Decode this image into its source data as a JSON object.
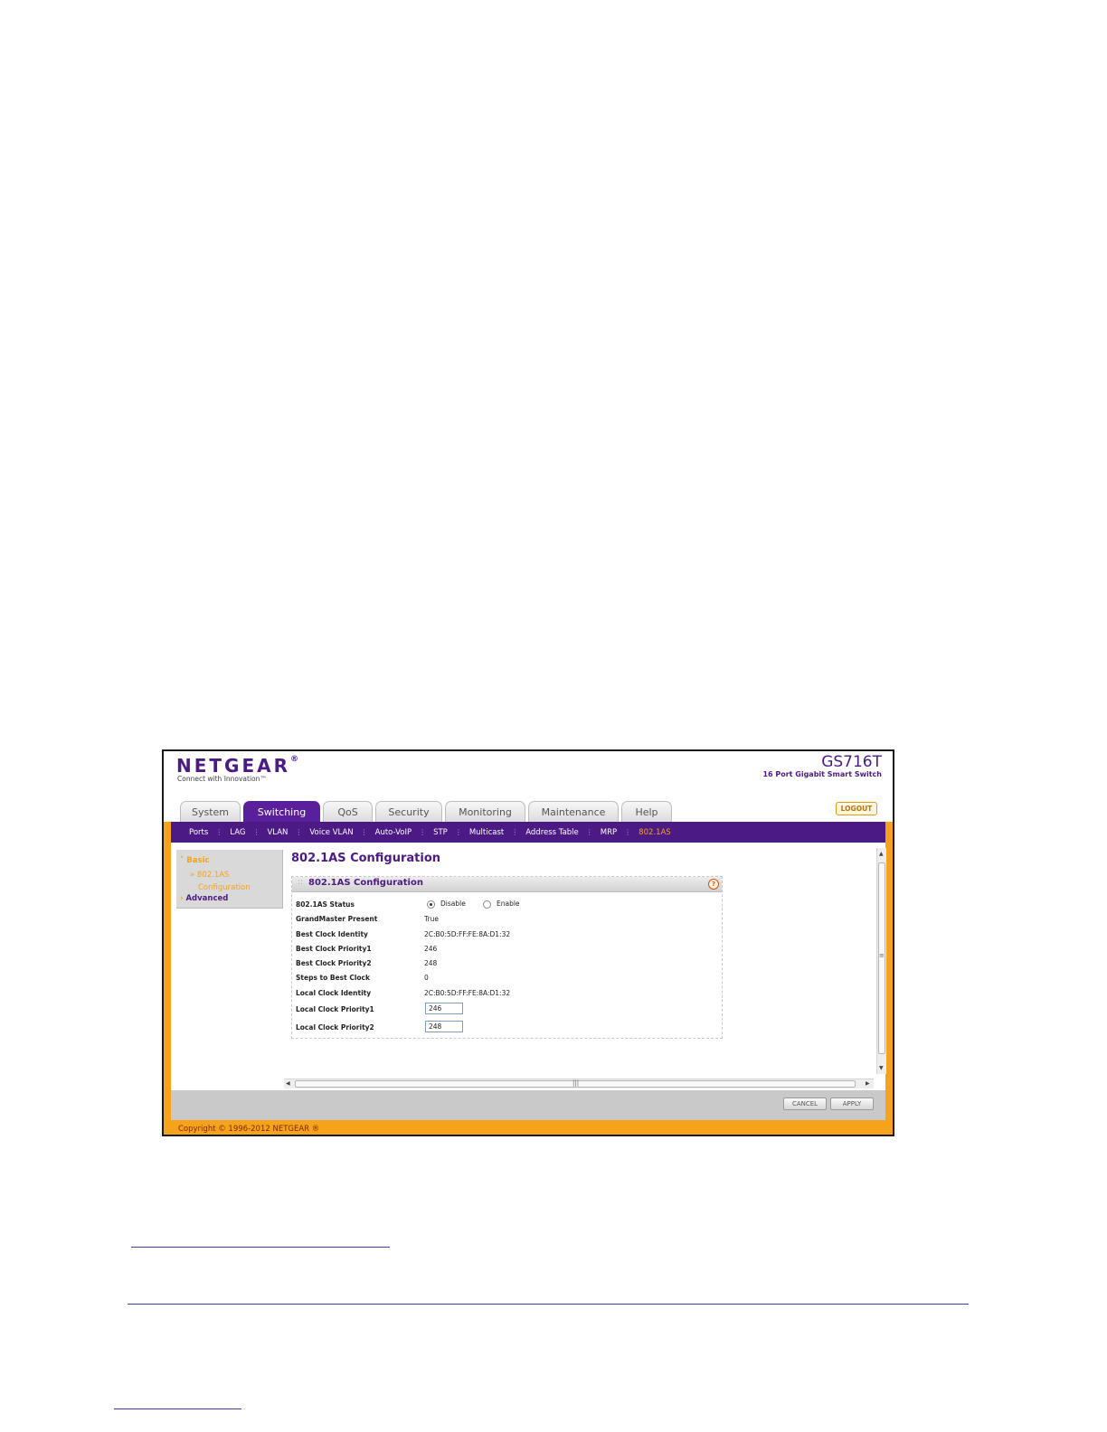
{
  "brand": {
    "logo": "NETGEAR",
    "logo_mark": "®",
    "tagline": "Connect with Innovation™",
    "model": "GS716T",
    "model_desc": "16 Port Gigabit Smart Switch"
  },
  "tabs": [
    {
      "label": "System"
    },
    {
      "label": "Switching"
    },
    {
      "label": "QoS"
    },
    {
      "label": "Security"
    },
    {
      "label": "Monitoring"
    },
    {
      "label": "Maintenance"
    },
    {
      "label": "Help"
    }
  ],
  "active_tab": "Switching",
  "logout_label": "LOGOUT",
  "subnav": [
    {
      "label": "Ports"
    },
    {
      "label": "LAG"
    },
    {
      "label": "VLAN"
    },
    {
      "label": "Voice VLAN"
    },
    {
      "label": "Auto-VoIP"
    },
    {
      "label": "STP"
    },
    {
      "label": "Multicast"
    },
    {
      "label": "Address Table"
    },
    {
      "label": "MRP"
    },
    {
      "label": "802.1AS"
    }
  ],
  "sidebar": {
    "basic": "Basic",
    "basic_child_line1": "802.1AS",
    "basic_child_line2": "Configuration",
    "advanced": "Advanced"
  },
  "page_title": "802.1AS Configuration",
  "panel": {
    "title": "802.1AS Configuration",
    "help_icon": "?",
    "status_label": "802.1AS Status",
    "status_options": [
      "Disable",
      "Enable"
    ],
    "status_selected": "Disable",
    "fields": [
      {
        "label": "GrandMaster Present",
        "value": "True"
      },
      {
        "label": "Best Clock Identity",
        "value": "2C:B0:5D:FF:FE:8A:D1:32"
      },
      {
        "label": "Best Clock Priority1",
        "value": "246"
      },
      {
        "label": "Best Clock Priority2",
        "value": "248"
      },
      {
        "label": "Steps to Best Clock",
        "value": "0"
      },
      {
        "label": "Local Clock Identity",
        "value": "2C:B0:5D:FF:FE:8A:D1:32"
      }
    ],
    "inputs": [
      {
        "label": "Local Clock Priority1",
        "value": "246"
      },
      {
        "label": "Local Clock Priority2",
        "value": "248"
      }
    ]
  },
  "buttons": {
    "cancel": "CANCEL",
    "apply": "APPLY"
  },
  "copyright": "Copyright © 1996-2012 NETGEAR ®",
  "colors": {
    "brand_purple": "#4b1a85",
    "accent_orange": "#f7a21b"
  }
}
